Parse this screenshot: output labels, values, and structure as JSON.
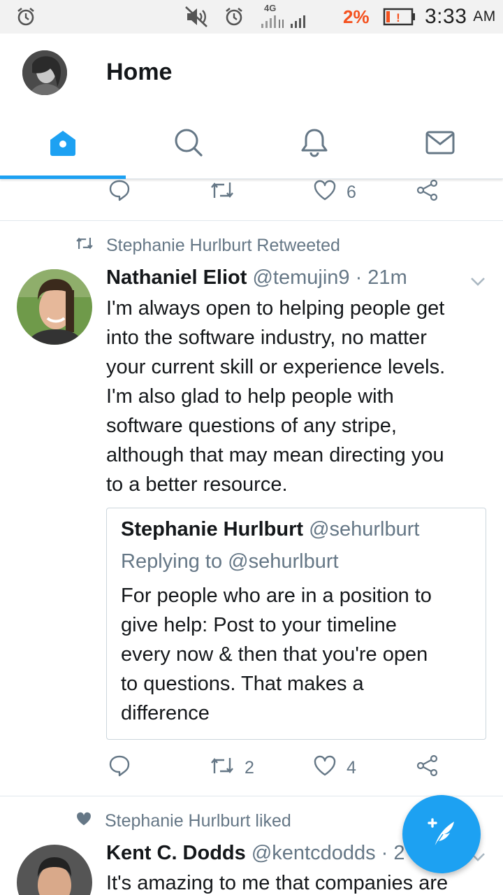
{
  "status_bar": {
    "network": "4G",
    "battery_percent": "2%",
    "time": "3:33",
    "ampm": "AM"
  },
  "header": {
    "title": "Home"
  },
  "tabs": [
    {
      "name": "home",
      "icon": "home-icon",
      "active": true
    },
    {
      "name": "search",
      "icon": "search-icon",
      "active": false
    },
    {
      "name": "notifications",
      "icon": "bell-icon",
      "active": false
    },
    {
      "name": "messages",
      "icon": "mail-icon",
      "active": false
    }
  ],
  "prev_tweet_actions": {
    "replies": "",
    "retweets": "",
    "likes": "6"
  },
  "tweet1": {
    "context": "Stephanie Hurlburt Retweeted",
    "name": "Nathaniel Eliot",
    "handle": "@temujin9 · 21m",
    "text_lines": [
      "I'm always open to helping people get",
      "into the software industry, no matter",
      "your current skill or experience levels.",
      "I'm also glad to help people with",
      "software questions of any stripe,",
      "although that may mean directing you",
      "to a better resource."
    ],
    "quote": {
      "name": "Stephanie Hurlburt",
      "handle": "@sehurlburt",
      "replying": "Replying to @sehurlburt",
      "text_lines": [
        "For people who are in a position to",
        "give help: Post to your timeline",
        "every now & then that you're open",
        "to questions. That makes a",
        "difference"
      ]
    },
    "actions": {
      "replies": "",
      "retweets": "2",
      "likes": "4"
    }
  },
  "tweet2": {
    "context": "Stephanie Hurlburt liked",
    "name": "Kent C. Dodds",
    "handle": "@kentcdodds · 2",
    "text_first_line": "It's amazing to me that companies are"
  },
  "colors": {
    "accent": "#1da1f2",
    "muted": "#657786",
    "text": "#14171a",
    "battery_warning": "#f4511e"
  }
}
